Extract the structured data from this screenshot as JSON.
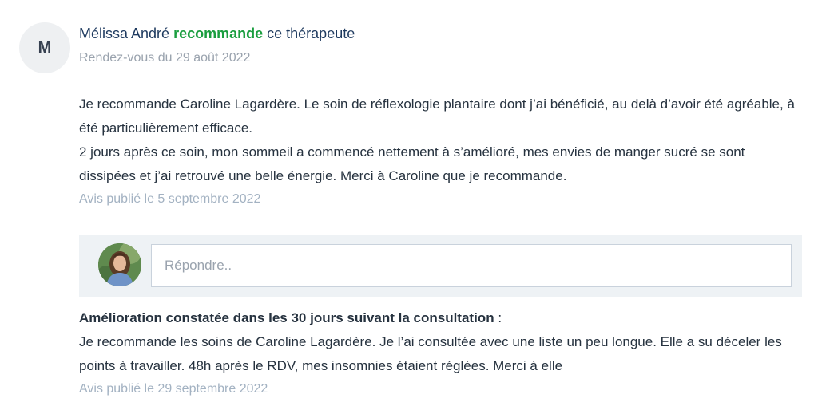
{
  "review": {
    "avatar_letter": "M",
    "author": "Mélissa André",
    "verb": "recommande",
    "object": "ce thérapeute",
    "appointment": "Rendez-vous du 29 août 2022",
    "paragraph1": "Je recommande Caroline Lagardère.  Le soin de réflexologie plantaire dont j’ai bénéficié, au delà d’avoir été agréable, à été particulièrement efficace.",
    "paragraph2": "2 jours après ce soin, mon sommeil a commencé nettement à s’amélioré, mes envies de manger sucré se sont dissipées et j’ai retrouvé une belle énergie. Merci à Caroline que je recommande.",
    "published": "Avis publié le 5 septembre 2022"
  },
  "reply": {
    "placeholder": "Répondre.."
  },
  "improvement": {
    "title": "Amélioration constatée dans les 30 jours suivant la consultation",
    "colon": " :",
    "text": "Je recommande les soins de Caroline Lagardère. Je l’ai consultée avec une liste un peu longue. Elle a su déceler les points à travailler. 48h après le RDV, mes insomnies étaient réglées.  Merci à elle",
    "published": "Avis publié le 29 septembre 2022"
  },
  "colors": {
    "recommend": "#1a9e3f",
    "author": "#1e3a5f",
    "muted": "#9aa3ae",
    "reply_bg": "#eef2f5"
  }
}
